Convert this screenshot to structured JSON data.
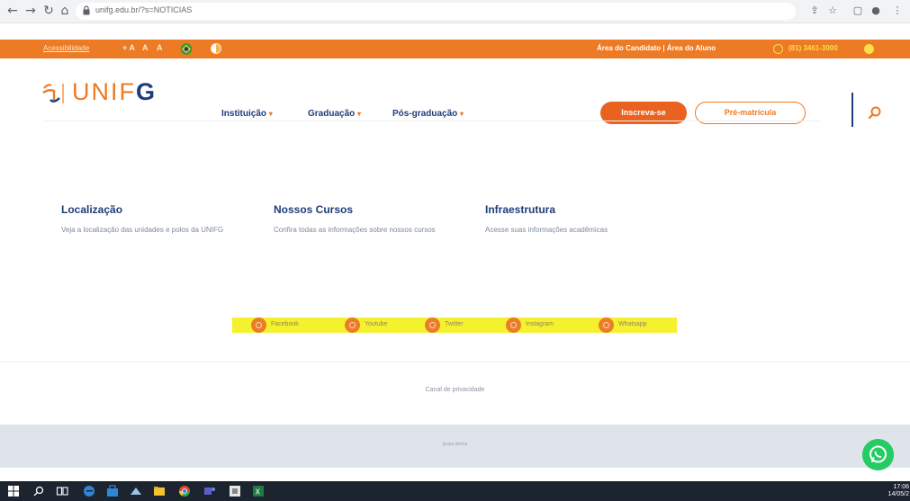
{
  "browser": {
    "url": "unifg.edu.br/?s=NOTICIAS",
    "icons": [
      "back-arrow-icon",
      "forward-arrow-icon",
      "reload-icon",
      "home-icon",
      "lock-icon",
      "share-icon",
      "star-icon",
      "tab-icon",
      "profile-icon",
      "menu-icon"
    ]
  },
  "top_bar": {
    "accessibility_label": "Acessibilidade",
    "font_controls": [
      "+ A",
      "A",
      "A"
    ],
    "candidate_links": "Área do Candidato | Área do Aluno",
    "phone": "(81) 3461-3000",
    "color": "#ed7a24"
  },
  "header": {
    "logo_prefix": "UNIF",
    "logo_suffix": "G",
    "menu": [
      {
        "label": "Instituição"
      },
      {
        "label": "Graduação"
      },
      {
        "label": "Pós-graduação"
      }
    ],
    "btn_primary": "Inscreva-se",
    "btn_secondary": "Pré-matrícula",
    "brand_orange": "#ed7a24",
    "brand_navy": "#1f3d7a"
  },
  "cards": [
    {
      "title": "Localização",
      "description": "Veja a localização das unidades e polos da UNIFG"
    },
    {
      "title": "Nossos Cursos",
      "description": "Confira todas as informações sobre nossos cursos"
    },
    {
      "title": "Infraestrutura",
      "description": "Acesse suas informações acadêmicas"
    }
  ],
  "social": [
    {
      "label": "Facebook",
      "icon": "facebook-icon"
    },
    {
      "label": "Youtube",
      "icon": "youtube-icon"
    },
    {
      "label": "Twitter",
      "icon": "twitter-icon"
    },
    {
      "label": "Instagram",
      "icon": "instagram-icon"
    },
    {
      "label": "Whatsapp",
      "icon": "whatsapp-icon"
    }
  ],
  "footer": {
    "privacy": "Canal de privacidade",
    "small_text": "grupo ânima"
  },
  "taskbar": {
    "clock_time": "17:06",
    "clock_date": "14/05/2"
  }
}
